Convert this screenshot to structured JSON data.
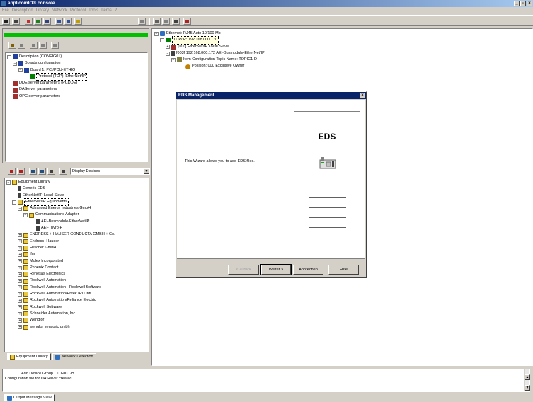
{
  "window": {
    "title": "applicomIO® console",
    "min": "_",
    "max": "▫",
    "close": "×"
  },
  "menu": [
    "File",
    "Description",
    "Library",
    "Network",
    "Protocol",
    "Tools",
    "Items",
    "?"
  ],
  "config_tree": {
    "root": "Description (CONFIG01)",
    "boards": "Boards configuration",
    "board1": "Board 1:  PCI/PCU-ETHIO",
    "protocol": "Protocol (TCP): EtherNet/IP",
    "dde": "DDE server parameters (PCDDE)",
    "daserver": "DAServer parameters",
    "opc": "OPC server parameters"
  },
  "network_tree": {
    "ethernet": "Ethernet: RJ45 Auto 10/100 Mb",
    "tcpip": "TCP/IP: 192.168.000.170",
    "local_slave": "[000] EtherNet/IP Local Slave",
    "device": "[003]  192.168.000.172   AEI-Busmodule-EtherNet/IP",
    "item_config": "Item Configuration  Topic Name: TOPIC1-D",
    "position": "Position: 000  Exclusive Owner"
  },
  "library_toolbar": {
    "combo_value": "Display Devices"
  },
  "library_tree": {
    "root": "Equipment Library",
    "generic": "Generic EDS",
    "local_slave": "EtherNet/IP Local Slave",
    "equipments": "EtherNet/IP Equipments",
    "advanced": "Advanced Energy Industries GmbH",
    "comm_adapter": "Communications Adapter",
    "aei_bus": "AEI-Busmodule-EtherNet/IP",
    "aei_thyro": "AEI-Thyro-P",
    "vendors": [
      "ENDRESS + HAUSER CONDUCTA GMBH + Co.",
      "Endress+Hauser",
      "Hilscher GmbH",
      "ifm",
      "Molex Incorporated",
      "Phoenix Contact",
      "Renesas Electronics",
      "Rockwell Automation",
      "Rockwell Automation - Rockwell Software",
      "Rockwell Automation/Entek IRD Intl.",
      "Rockwell Automation/Reliance Electric",
      "Rockwell Software",
      "Schneider Automation, Inc.",
      "Wenglor",
      "wenglor sensoric gmbh"
    ]
  },
  "left_tabs": {
    "library": "Equipment Library",
    "detection": "Network Detection"
  },
  "output": {
    "line1": "Add Device Group : TOPIC1-B.",
    "line2": "Configuration file for DAServer created.",
    "tab": "Output Message View"
  },
  "dialog": {
    "title": "EDS Management",
    "close": "×",
    "text": "This Wizard allows you to add EDS files.",
    "card_title": "EDS",
    "back": "< Zurück",
    "next": "Weiter >",
    "cancel": "Abbrechen",
    "help": "Hilfe"
  }
}
